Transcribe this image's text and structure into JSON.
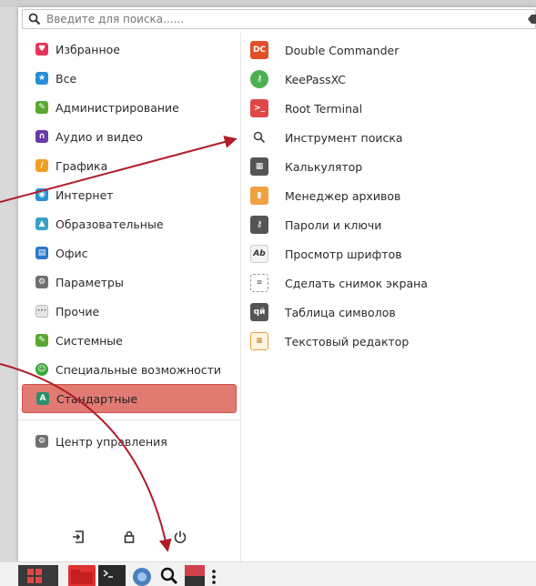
{
  "search": {
    "placeholder": "Введите для поиска......"
  },
  "categories": [
    {
      "label": "Избранное",
      "icon": "heart-icon",
      "color": "#e8335a"
    },
    {
      "label": "Все",
      "icon": "star-icon",
      "color": "#2a8fd6"
    },
    {
      "label": "Администрирование",
      "icon": "wrench-icon",
      "color": "#5aa832"
    },
    {
      "label": "Аудио и видео",
      "icon": "headphones-icon",
      "color": "#6a3aa8"
    },
    {
      "label": "Графика",
      "icon": "pencil-icon",
      "color": "#f0a020"
    },
    {
      "label": "Интернет",
      "icon": "globe-icon",
      "color": "#2a8fd6"
    },
    {
      "label": "Образовательные",
      "icon": "flask-icon",
      "color": "#3aa0c8"
    },
    {
      "label": "Офис",
      "icon": "document-icon",
      "color": "#2a78c8"
    },
    {
      "label": "Параметры",
      "icon": "gear-icon",
      "color": "#707070"
    },
    {
      "label": "Прочие",
      "icon": "dots-icon",
      "color": "#909090"
    },
    {
      "label": "Системные",
      "icon": "wrench-icon",
      "color": "#5aa832"
    },
    {
      "label": "Специальные возможности",
      "icon": "accessibility-icon",
      "color": "#3aa83a"
    },
    {
      "label": "Стандартные",
      "icon": "accessories-icon",
      "color": "#2a8f6a"
    }
  ],
  "control_center": {
    "label": "Центр управления",
    "icon": "gear-icon"
  },
  "apps": [
    {
      "label": "Double Commander",
      "icon": "double-commander-icon",
      "color": "#e0502a"
    },
    {
      "label": "KeePassXC",
      "icon": "key-icon",
      "color": "#4caf50"
    },
    {
      "label": "Root Terminal",
      "icon": "terminal-icon",
      "color": "#e04848"
    },
    {
      "label": "Инструмент поиска",
      "icon": "search-icon",
      "color": "#444444"
    },
    {
      "label": "Калькулятор",
      "icon": "calculator-icon",
      "color": "#555555"
    },
    {
      "label": "Менеджер архивов",
      "icon": "archive-icon",
      "color": "#f0a040"
    },
    {
      "label": "Пароли и ключи",
      "icon": "keys-icon",
      "color": "#555555"
    },
    {
      "label": "Просмотр шрифтов",
      "icon": "font-icon",
      "color": "#333333"
    },
    {
      "label": "Сделать снимок экрана",
      "icon": "screenshot-icon",
      "color": "#707070"
    },
    {
      "label": "Таблица символов",
      "icon": "charmap-icon",
      "color": "#555555"
    },
    {
      "label": "Текстовый редактор",
      "icon": "text-editor-icon",
      "color": "#e8a040"
    }
  ],
  "colors": {
    "accent": "#e07a72",
    "accent_border": "#d0524a",
    "arrow": "#b01c28"
  }
}
